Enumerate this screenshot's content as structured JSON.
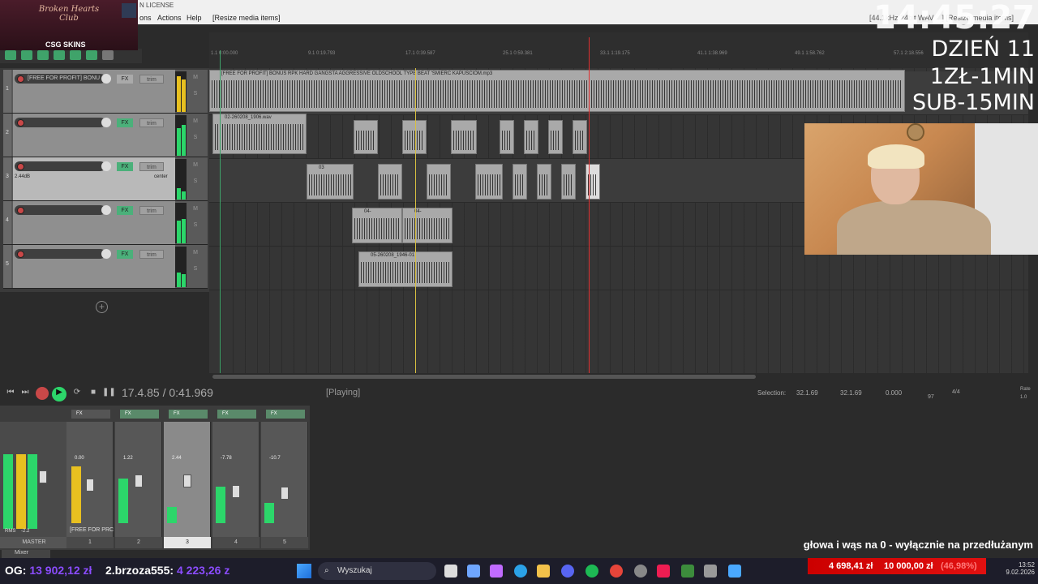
{
  "window": {
    "title": "N LICENSE",
    "status_info": "[44.1kHz 24bit WAV ...] [Resize media items]"
  },
  "menu": {
    "items": [
      "ons",
      "Actions",
      "Help",
      "[Resize media items]"
    ]
  },
  "overlay": {
    "clock": "14:45:27",
    "day": "DZIEŃ 11",
    "rate1": "1ZŁ-1MIN",
    "rate2": "SUB-15MIN"
  },
  "stream_brand": {
    "name": "Broken Hearts Club",
    "sponsor": "CSG SKINS"
  },
  "ruler": {
    "marks": [
      "1.1\n0:00.000",
      "9.1\n0:19.793",
      "17.1\n0:39.587",
      "25.1\n0:59.381",
      "33.1\n1:19.175",
      "41.1\n1:38.969",
      "49.1\n1:58.762",
      "57.1\n2:18.556"
    ]
  },
  "tracks": [
    {
      "num": "1",
      "name": "[FREE FOR PROFIT] BONU",
      "vol": "",
      "pan": ""
    },
    {
      "num": "2",
      "name": "",
      "vol": "",
      "pan": ""
    },
    {
      "num": "3",
      "name": "",
      "vol": "2.44dB",
      "pan": "center"
    },
    {
      "num": "4",
      "name": "",
      "vol": "",
      "pan": ""
    },
    {
      "num": "5",
      "name": "",
      "vol": "",
      "pan": ""
    }
  ],
  "track_buttons": {
    "fx": "FX",
    "trim": "trim",
    "m": "M",
    "s": "S"
  },
  "items": {
    "t1": "[FREE FOR PROFIT] BONUS RPK  HARD GANGSTA AGGRESSIVE OLDSCHOOL TYPE BEAT 'ŚMIERĆ KAPUŚCIOM.mp3",
    "t2": "02-260208_1906.wav",
    "t3": "03",
    "t4a": "04-",
    "t4b": "04-",
    "t5": "05-260208_1946-01"
  },
  "transport": {
    "position": "17.4.85 / 0:41.969",
    "state": "[Playing]",
    "selection_label": "Selection:",
    "sel_start": "32.1.69",
    "sel_end": "32.1.69",
    "sel_len": "0.000",
    "bpm": "97",
    "sig": "4/4",
    "rate_label": "Rate",
    "rate": "1.0"
  },
  "mixer": {
    "master_label": "MASTER",
    "rms": "RMS",
    "master_val": "-2.2",
    "track_name": "[FREE FOR PRC",
    "strips": [
      "1",
      "2",
      "3",
      "4",
      "5"
    ],
    "levels": [
      "0.00",
      "1.22",
      "2.44",
      "-7.78",
      "-10.7"
    ],
    "tab": "Mixer"
  },
  "banner": "głowa i wąs na 0 - wyłącznie na przedłużanym",
  "taskbar": {
    "og_label": "OG:",
    "og_value": "13 902,12 zł",
    "top_label": "2.brzoza555:",
    "top_value": "4 223,26 z",
    "search": "Wyszukaj",
    "money1": "4 698,41 zł",
    "money2": "10 000,00 zł",
    "money_pct": "(46,98%)",
    "time": "13:52",
    "date": "9.02.2026"
  },
  "colors": {
    "accent_green": "#2cd66a",
    "record_red": "#c94848",
    "purple": "#8b4cff",
    "cursor_red": "#e03030"
  }
}
